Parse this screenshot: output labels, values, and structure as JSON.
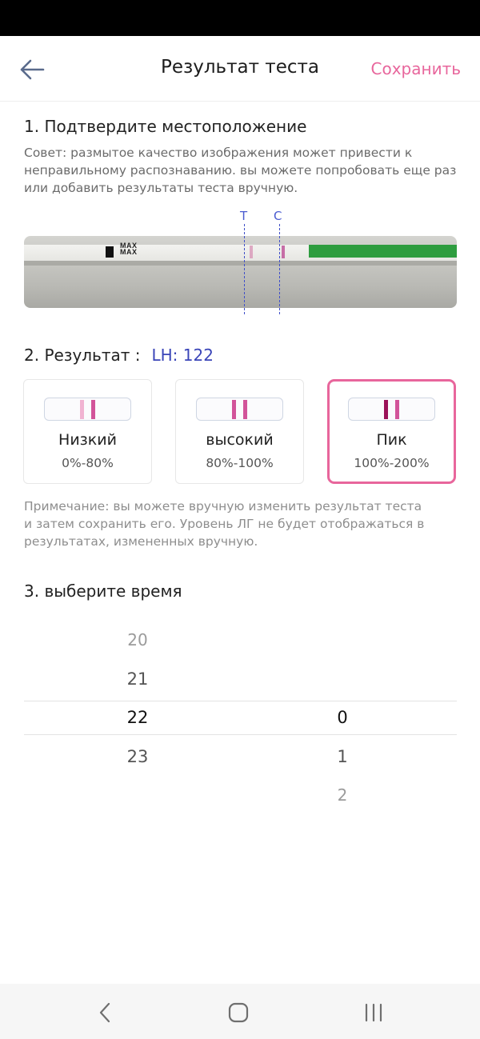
{
  "header": {
    "title": "Результат теста",
    "save_label": "Сохранить"
  },
  "section1": {
    "title": "1. Подтвердите местоположение",
    "hint_line1": "Совет: размытое качество изображения может привести к",
    "hint_line2": "неправильному распознаванию. вы можете попробовать еще раз",
    "hint_line3": "или добавить результаты теста вручную.",
    "marker_t": "T",
    "marker_c": "C",
    "strip_text_1": "MAX",
    "strip_text_2": "MAX"
  },
  "section2": {
    "label": "2. Результат :",
    "value": "LH: 122",
    "cards": [
      {
        "name": "Низкий",
        "range": "0%-80%",
        "selected": false
      },
      {
        "name": "высокий",
        "range": "80%-100%",
        "selected": false
      },
      {
        "name": "Пик",
        "range": "100%-200%",
        "selected": true
      }
    ],
    "note_line1": "Примечание: вы можете вручную изменить результат теста",
    "note_line2": "и затем сохранить его. Уровень ЛГ не будет отображаться в",
    "note_line3": "результатах, измененных вручную."
  },
  "section3": {
    "title": "3. выберите время",
    "hours": [
      "20",
      "21",
      "22",
      "23"
    ],
    "selected_hour": "22",
    "minutes": [
      "0",
      "1",
      "2"
    ],
    "selected_minute": "0"
  },
  "colors": {
    "accent": "#e8669c",
    "lh_value": "#3a45b8",
    "marker": "#4a5bd0"
  },
  "icons": {
    "back": "arrow-left-icon",
    "nav_back": "chevron-left-icon",
    "nav_home": "home-icon",
    "nav_recents": "recents-icon"
  }
}
